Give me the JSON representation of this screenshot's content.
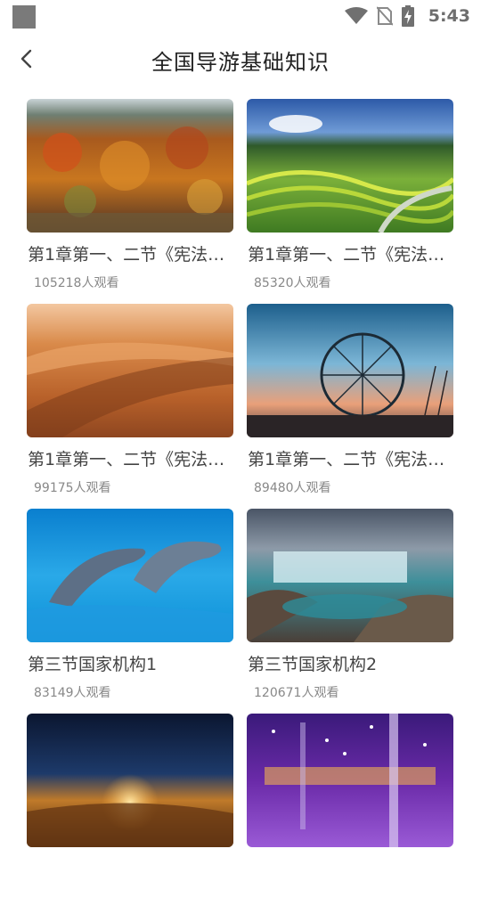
{
  "status_bar": {
    "time": "5:43",
    "icons": [
      "app-icon",
      "wifi-icon",
      "no-sim-icon",
      "battery-charging-icon"
    ]
  },
  "header": {
    "title": "全国导游基础知识",
    "back_icon": "chevron-left-icon"
  },
  "courses": [
    {
      "title": "第1章第一、二节《宪法…",
      "views": "105218人观看",
      "image": "autumn-forest"
    },
    {
      "title": "第1章第一、二节《宪法…",
      "views": "85320人观看",
      "image": "rice-terraces"
    },
    {
      "title": "第1章第一、二节《宪法…",
      "views": "99175人观看",
      "image": "desert-dunes"
    },
    {
      "title": "第1章第一、二节《宪法…",
      "views": "89480人观看",
      "image": "ferris-wheel"
    },
    {
      "title": "第三节国家机构1",
      "views": "83149人观看",
      "image": "dolphins"
    },
    {
      "title": "第三节国家机构2",
      "views": "120671人观看",
      "image": "waterfall"
    },
    {
      "title": "",
      "views": "",
      "image": "desert-night"
    },
    {
      "title": "",
      "views": "",
      "image": "purple-lights-hall"
    }
  ]
}
